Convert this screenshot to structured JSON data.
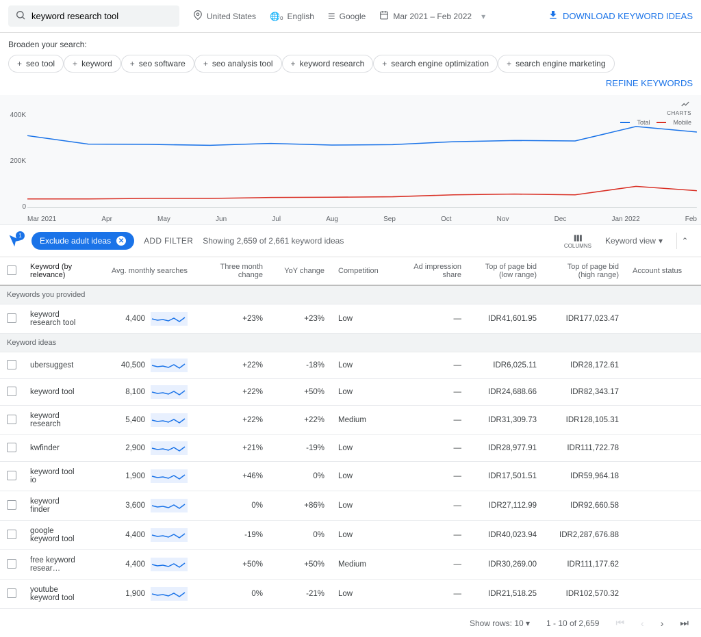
{
  "top": {
    "search_value": "keyword research tool",
    "location": "United States",
    "language": "English",
    "network": "Google",
    "date_range": "Mar 2021 – Feb 2022",
    "download": "DOWNLOAD KEYWORD IDEAS"
  },
  "broaden": {
    "label": "Broaden your search:",
    "chips": [
      "seo tool",
      "keyword",
      "seo software",
      "seo analysis tool",
      "keyword research",
      "search engine optimization",
      "search engine marketing"
    ],
    "refine": "REFINE KEYWORDS"
  },
  "controls": {
    "exclude": "Exclude adult ideas",
    "add_filter": "ADD FILTER",
    "showing": "Showing 2,659 of 2,661 keyword ideas",
    "columns": "COLUMNS",
    "view": "Keyword view",
    "charts_label": "CHARTS"
  },
  "legend": {
    "total": "Total",
    "mobile": "Mobile"
  },
  "headers": {
    "kw": "Keyword (by relevance)",
    "avg": "Avg. monthly searches",
    "tmc": "Three month change",
    "yoy": "YoY change",
    "comp": "Competition",
    "ais": "Ad impression share",
    "bidlow": "Top of page bid (low range)",
    "bidhigh": "Top of page bid (high range)",
    "acct": "Account status"
  },
  "sections": {
    "provided": "Keywords you provided",
    "ideas": "Keyword ideas"
  },
  "provided_row": {
    "kw": "keyword research tool",
    "avg": "4,400",
    "tmc": "+23%",
    "yoy": "+23%",
    "comp": "Low",
    "ais": "—",
    "bidlow": "IDR41,601.95",
    "bidhigh": "IDR177,023.47"
  },
  "rows": [
    {
      "kw": "ubersuggest",
      "avg": "40,500",
      "tmc": "+22%",
      "yoy": "-18%",
      "comp": "Low",
      "ais": "—",
      "bidlow": "IDR6,025.11",
      "bidhigh": "IDR28,172.61"
    },
    {
      "kw": "keyword tool",
      "avg": "8,100",
      "tmc": "+22%",
      "yoy": "+50%",
      "comp": "Low",
      "ais": "—",
      "bidlow": "IDR24,688.66",
      "bidhigh": "IDR82,343.17"
    },
    {
      "kw": "keyword research",
      "avg": "5,400",
      "tmc": "+22%",
      "yoy": "+22%",
      "comp": "Medium",
      "ais": "—",
      "bidlow": "IDR31,309.73",
      "bidhigh": "IDR128,105.31"
    },
    {
      "kw": "kwfinder",
      "avg": "2,900",
      "tmc": "+21%",
      "yoy": "-19%",
      "comp": "Low",
      "ais": "—",
      "bidlow": "IDR28,977.91",
      "bidhigh": "IDR111,722.78"
    },
    {
      "kw": "keyword tool io",
      "avg": "1,900",
      "tmc": "+46%",
      "yoy": "0%",
      "comp": "Low",
      "ais": "—",
      "bidlow": "IDR17,501.51",
      "bidhigh": "IDR59,964.18"
    },
    {
      "kw": "keyword finder",
      "avg": "3,600",
      "tmc": "0%",
      "yoy": "+86%",
      "comp": "Low",
      "ais": "—",
      "bidlow": "IDR27,112.99",
      "bidhigh": "IDR92,660.58"
    },
    {
      "kw": "google keyword tool",
      "avg": "4,400",
      "tmc": "-19%",
      "yoy": "0%",
      "comp": "Low",
      "ais": "—",
      "bidlow": "IDR40,023.94",
      "bidhigh": "IDR2,287,676.88"
    },
    {
      "kw": "free keyword resear…",
      "avg": "4,400",
      "tmc": "+50%",
      "yoy": "+50%",
      "comp": "Medium",
      "ais": "—",
      "bidlow": "IDR30,269.00",
      "bidhigh": "IDR111,177.62"
    },
    {
      "kw": "youtube keyword tool",
      "avg": "1,900",
      "tmc": "0%",
      "yoy": "-21%",
      "comp": "Low",
      "ais": "—",
      "bidlow": "IDR21,518.25",
      "bidhigh": "IDR102,570.32"
    }
  ],
  "pager": {
    "show_rows": "Show rows:",
    "rows": "10",
    "range": "1 - 10 of 2,659"
  },
  "chart_data": {
    "type": "line",
    "x": [
      "Mar 2021",
      "Apr",
      "May",
      "Jun",
      "Jul",
      "Aug",
      "Sep",
      "Oct",
      "Nov",
      "Dec",
      "Jan 2022",
      "Feb"
    ],
    "ylim": [
      0,
      400000
    ],
    "y_ticks": [
      "400K",
      "200K",
      "0"
    ],
    "series": [
      {
        "name": "Total",
        "color": "#1a73e8",
        "values": [
          300000,
          265000,
          264000,
          260000,
          268000,
          261000,
          263000,
          275000,
          280000,
          278000,
          338000,
          315000
        ]
      },
      {
        "name": "Mobile",
        "color": "#d93025",
        "values": [
          38000,
          38000,
          40000,
          40000,
          44000,
          45000,
          47000,
          55000,
          58000,
          55000,
          90000,
          72000
        ]
      }
    ]
  }
}
